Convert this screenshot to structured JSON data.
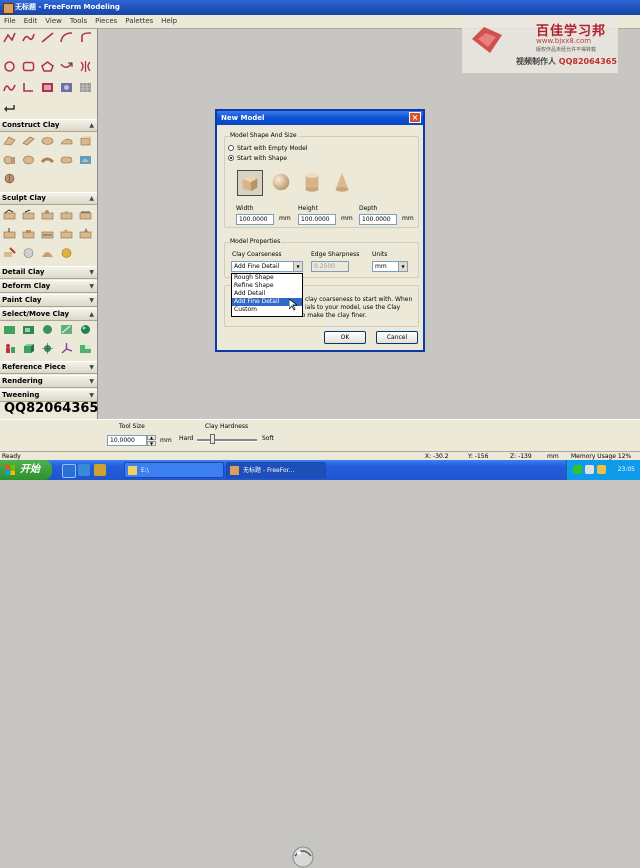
{
  "window": {
    "title": "无标题 - FreeForm Modeling"
  },
  "menu": [
    "File",
    "Edit",
    "View",
    "Tools",
    "Pieces",
    "Palettes",
    "Help"
  ],
  "sections": {
    "construct_clay": "Construct Clay",
    "sculpt_clay": "Sculpt Clay",
    "detail_clay": "Detail Clay",
    "deform_clay": "Deform Clay",
    "paint_clay": "Paint Clay",
    "select_move_clay": "Select/Move Clay",
    "reference_piece": "Reference Piece",
    "rendering": "Rendering",
    "tweening": "Tweening"
  },
  "watermark": {
    "title": "百佳学习邦",
    "url": "www.bjxx8.com",
    "note": "版权作品未经允许不得转载",
    "author_label": "视频制作人",
    "author_qq": "QQ82064365"
  },
  "overlay_qq": "QQ82064365",
  "dialog": {
    "title": "New Model",
    "shape_group": "Model Shape And Size",
    "radio_empty": "Start with Empty Model",
    "radio_shape": "Start with Shape",
    "width_label": "Width",
    "height_label": "Height",
    "depth_label": "Depth",
    "width_value": "100.0000",
    "height_value": "100.0000",
    "depth_value": "100.0000",
    "unit_mm": "mm",
    "props_group": "Model Properties",
    "coarseness_label": "Clay Coarseness",
    "coarseness_value": "Add Fine Detail",
    "edge_label": "Edge Sharpness",
    "edge_value": "0.2500",
    "units_label": "Units",
    "units_value": "mm",
    "dropdown_options": [
      "Rough Shape",
      "Refine Shape",
      "Add Detail",
      "Add Fine Detail",
      "Custom"
    ],
    "dropdown_selected_index": 3,
    "info_text_1": "clay coarseness to start with. When",
    "info_text_2": "ials to your model, use the Clay",
    "info_text_3": "Coarseness command to make the clay finer.",
    "ok": "OK",
    "cancel": "Cancel"
  },
  "bottom": {
    "tool_size_label": "Tool Size",
    "tool_size_value": "10.0000",
    "unit": "mm",
    "clay_hardness_label": "Clay Hardness",
    "hard": "Hard",
    "soft": "Soft",
    "hardness_level": 0.25
  },
  "status": {
    "ready": "Ready",
    "x": "X: -30.2",
    "y": "Y: -156",
    "z": "Z: -139",
    "unit": "mm",
    "memory": "Memory Usage  12%"
  },
  "taskbar": {
    "start": "开始",
    "task1": "E:\\",
    "task2": "无标题 - FreeFor...",
    "clock": "23:05"
  },
  "colors": {
    "title_blue": "#1d4fb8",
    "panel": "#ece9d8",
    "workspace": "#c8c6c3",
    "clay_red": "#b03050",
    "clay_tan": "#d8b890"
  }
}
